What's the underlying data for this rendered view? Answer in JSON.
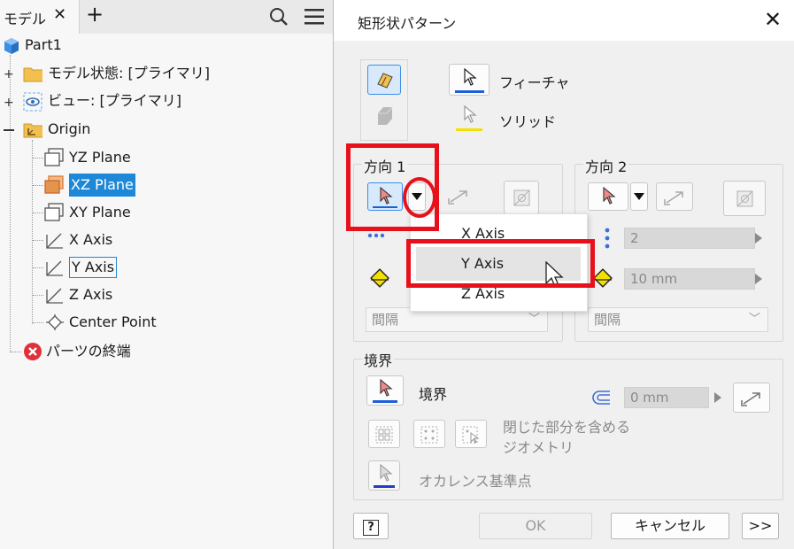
{
  "browser": {
    "tab_label": "モデル",
    "tab_close": "✕",
    "tab_add": "+",
    "items": [
      {
        "label": "Part1"
      },
      {
        "label": "モデル状態: [プライマリ]"
      },
      {
        "label": "ビュー: [プライマリ]"
      },
      {
        "label": "Origin"
      },
      {
        "label": "YZ Plane"
      },
      {
        "label": "XZ Plane"
      },
      {
        "label": "XY Plane"
      },
      {
        "label": "X Axis"
      },
      {
        "label": "Y Axis"
      },
      {
        "label": "Z Axis"
      },
      {
        "label": "Center Point"
      },
      {
        "label": "パーツの終端"
      }
    ]
  },
  "dialog": {
    "title": "矩形状パターン",
    "close": "✕",
    "feature_label": "フィーチャ",
    "solid_label": "ソリッド",
    "direction1": {
      "title": "方向 1",
      "spacing_dropdown": "間隔"
    },
    "direction2": {
      "title": "方向 2",
      "count_value": "2",
      "distance_value": "10 mm",
      "spacing_dropdown": "間隔"
    },
    "axis_menu": {
      "items": [
        "X Axis",
        "Y Axis",
        "Z Axis"
      ],
      "hovered": "Y Axis"
    },
    "boundary": {
      "title": "境界",
      "boundary_label": "境界",
      "offset_value": "0 mm",
      "closed_geometry_label_line1": "閉じた部分を含める",
      "closed_geometry_label_line2": "ジオメトリ",
      "base_point_label": "オカレンス基準点"
    },
    "buttons": {
      "help": "?",
      "ok": "OK",
      "cancel": "キャンセル",
      "more": ">>"
    }
  },
  "colors": {
    "highlight_red": "#e8111b",
    "selection_blue": "#1e88d8",
    "sketch_orange": "#e59450"
  }
}
